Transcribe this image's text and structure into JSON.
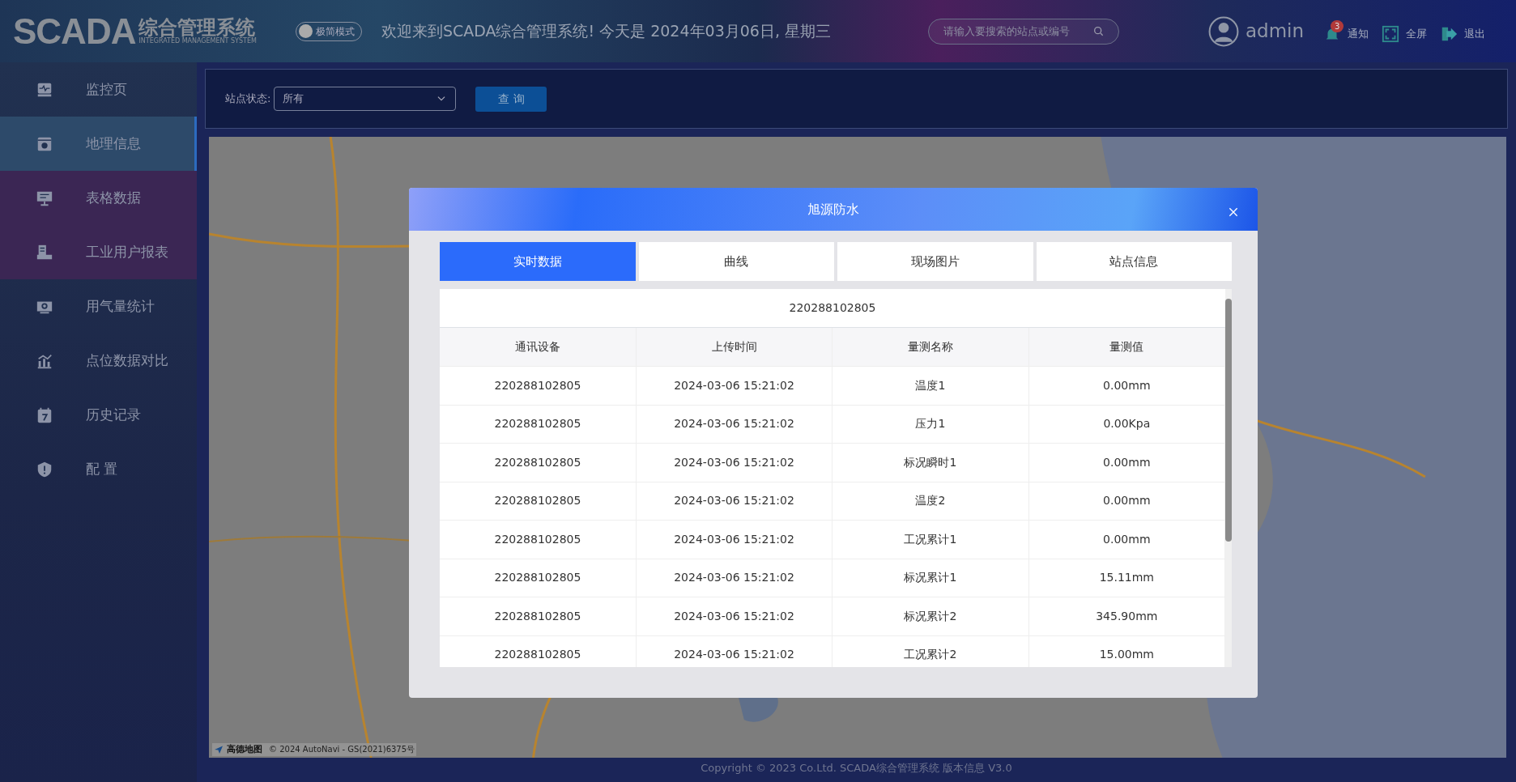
{
  "header": {
    "logo_text": "SCADA",
    "logo_title": "综合管理系统",
    "logo_subtitle": "INTEGRATED MANAGEMENT SYSTEM",
    "mode_toggle": {
      "label": "极简模式",
      "on": false
    },
    "welcome": "欢迎来到SCADA综合管理系统!   今天是 2024年03月06日, 星期三",
    "search": {
      "placeholder": "请输入要搜索的站点或编号"
    },
    "user": "admin",
    "actions": [
      {
        "kind": "bell",
        "label": "通知",
        "badge": "3"
      },
      {
        "kind": "fullscreen",
        "label": "全屏"
      },
      {
        "kind": "logout",
        "label": "退出"
      }
    ]
  },
  "sidebar": {
    "items": [
      {
        "kind": "monitor",
        "label": "监控页",
        "selected": false
      },
      {
        "kind": "geo",
        "label": "地理信息",
        "selected": true
      },
      {
        "kind": "table",
        "label": "表格数据",
        "selected": false
      },
      {
        "kind": "report",
        "label": "工业用户报表",
        "selected": false
      },
      {
        "kind": "gas",
        "label": "用气量统计",
        "selected": false
      },
      {
        "kind": "chart",
        "label": "点位数据对比",
        "selected": false
      },
      {
        "kind": "history",
        "label": "历史记录",
        "selected": false
      },
      {
        "kind": "shield",
        "label": "配 置",
        "selected": false
      }
    ]
  },
  "filter": {
    "label": "站点状态:",
    "value": "所有",
    "button": "查 询"
  },
  "map": {
    "kind": "picture",
    "logo": "高德地图",
    "attribution": "© 2024 AutoNavi - GS(2021)6375号"
  },
  "dialog": {
    "title": "旭源防水",
    "tabs": [
      {
        "label": "实时数据",
        "selected": true
      },
      {
        "label": "曲线",
        "selected": false
      },
      {
        "label": "现场图片",
        "selected": false
      },
      {
        "label": "站点信息",
        "selected": false
      }
    ],
    "table": {
      "caption": "220288102805",
      "columns": [
        "通讯设备",
        "上传时间",
        "量测名称",
        "量测值"
      ],
      "rows": [
        [
          "220288102805",
          "2024-03-06 15:21:02",
          "温度1",
          "0.00mm"
        ],
        [
          "220288102805",
          "2024-03-06 15:21:02",
          "压力1",
          "0.00Kpa"
        ],
        [
          "220288102805",
          "2024-03-06 15:21:02",
          "标况瞬时1",
          "0.00mm"
        ],
        [
          "220288102805",
          "2024-03-06 15:21:02",
          "温度2",
          "0.00mm"
        ],
        [
          "220288102805",
          "2024-03-06 15:21:02",
          "工况累计1",
          "0.00mm"
        ],
        [
          "220288102805",
          "2024-03-06 15:21:02",
          "标况累计1",
          "15.11mm"
        ],
        [
          "220288102805",
          "2024-03-06 15:21:02",
          "标况累计2",
          "345.90mm"
        ],
        [
          "220288102805",
          "2024-03-06 15:21:02",
          "工况累计2",
          "15.00mm"
        ]
      ]
    }
  },
  "footer": "Copyright © 2023 Co.Ltd. SCADA综合管理系统 版本信息 V3.0"
}
